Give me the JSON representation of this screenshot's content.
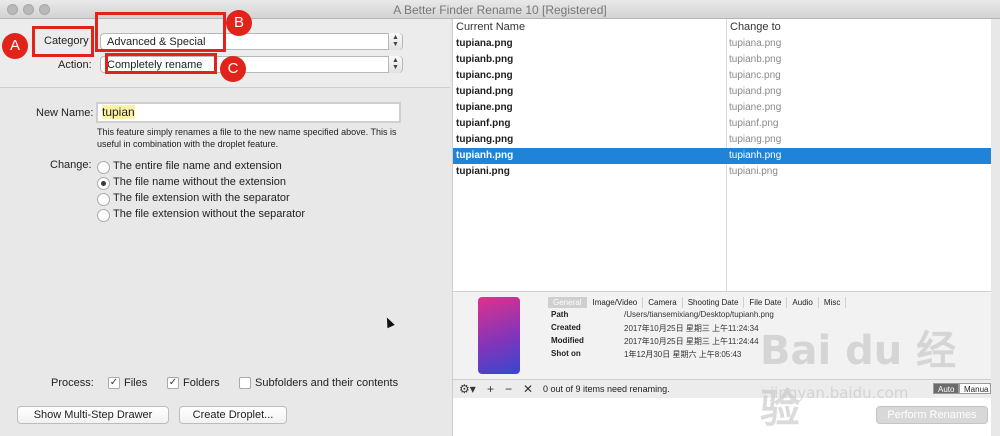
{
  "window": {
    "title": "A Better Finder Rename 10 [Registered]"
  },
  "form": {
    "category_label": "Category",
    "category_value": "Advanced & Special",
    "action_label": "Action:",
    "action_value": "Completely rename",
    "new_name_label": "New Name:",
    "new_name_value": "tupian",
    "help_line1": "This feature simply renames a file to the new name specified above. This is",
    "help_line2": "useful in combination with the droplet feature.",
    "change_label": "Change:",
    "change_options": [
      {
        "label": "The entire file name and extension",
        "selected": false
      },
      {
        "label": "The file name without the extension",
        "selected": true
      },
      {
        "label": "The file extension with the separator",
        "selected": false
      },
      {
        "label": "The file extension without the separator",
        "selected": false
      }
    ]
  },
  "annotations": {
    "a": "A",
    "b": "B",
    "c": "C"
  },
  "process": {
    "label": "Process:",
    "files": "Files",
    "folders": "Folders",
    "subfolders": "Subfolders and their contents",
    "files_checked": true,
    "folders_checked": true,
    "subfolders_checked": false
  },
  "buttons": {
    "multi_step": "Show Multi-Step Drawer",
    "droplet": "Create Droplet...",
    "perform": "Perform Renames"
  },
  "list": {
    "col_current": "Current Name",
    "col_change": "Change to",
    "rows": [
      {
        "current": "tupiana.png",
        "change": "tupiana.png"
      },
      {
        "current": "tupianb.png",
        "change": "tupianb.png"
      },
      {
        "current": "tupianc.png",
        "change": "tupianc.png"
      },
      {
        "current": "tupiand.png",
        "change": "tupiand.png"
      },
      {
        "current": "tupiane.png",
        "change": "tupiane.png"
      },
      {
        "current": "tupianf.png",
        "change": "tupianf.png"
      },
      {
        "current": "tupiang.png",
        "change": "tupiang.png"
      },
      {
        "current": "tupianh.png",
        "change": "tupianh.png",
        "selected": true
      },
      {
        "current": "tupiani.png",
        "change": "tupiani.png"
      }
    ]
  },
  "preview": {
    "tabs": [
      "General",
      "Image/Video",
      "Camera",
      "Shooting Date",
      "File Date",
      "Audio",
      "Misc"
    ],
    "active_tab": "General",
    "info": [
      {
        "key": "Path",
        "value": "/Users/tiansemixiang/Desktop/tupianh.png"
      },
      {
        "key": "Created",
        "value": "2017年10月25日 星期三 上午11:24:34"
      },
      {
        "key": "Modified",
        "value": "2017年10月25日 星期三 上午11:24:44"
      },
      {
        "key": "Shot on",
        "value": "1年12月30日 星期六 上午8:05:43"
      }
    ]
  },
  "status": {
    "text": "0 out of 9 items need renaming.",
    "auto": "Auto",
    "manual": "Manua",
    "tools": {
      "gear": "⚙▾",
      "add": "+",
      "remove": "−",
      "clear": "✕"
    }
  },
  "watermark": {
    "logo": "Bai du 经验",
    "url": "jingyan.baidu.com"
  }
}
